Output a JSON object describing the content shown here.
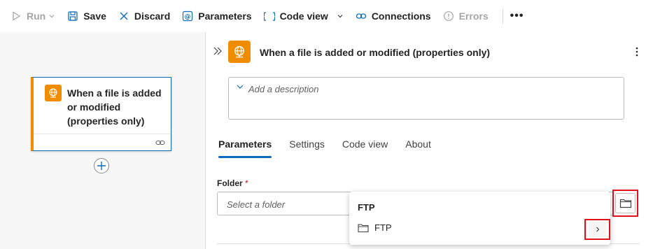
{
  "toolbar": {
    "run_label": "Run",
    "save_label": "Save",
    "discard_label": "Discard",
    "parameters_label": "Parameters",
    "codeview_label": "Code view",
    "connections_label": "Connections",
    "errors_label": "Errors",
    "more_label": "•••"
  },
  "canvas": {
    "card_title": "When a file is added or modified (properties only)"
  },
  "panel": {
    "title": "When a file is added or modified (properties only)",
    "description_placeholder": "Add a description",
    "tabs": [
      {
        "label": "Parameters",
        "active": true
      },
      {
        "label": "Settings",
        "active": false
      },
      {
        "label": "Code view",
        "active": false
      },
      {
        "label": "About",
        "active": false
      }
    ],
    "folder_label": "Folder",
    "folder_required_mark": "*",
    "folder_placeholder": "Select a folder"
  },
  "dropdown": {
    "header": "FTP",
    "items": [
      {
        "label": "FTP"
      }
    ]
  },
  "colors": {
    "accent": "#0f6cbd",
    "trigger_orange": "#f08c00",
    "highlight_red": "#e3101c",
    "disabled_text": "#a6a6a6"
  }
}
